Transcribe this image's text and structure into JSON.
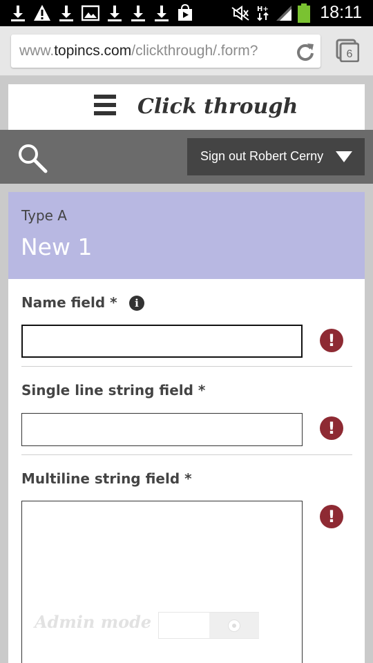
{
  "status_bar": {
    "time": "18:11",
    "icons": [
      "download-icon",
      "warning-icon",
      "download-icon",
      "image-icon",
      "download-icon",
      "download-icon",
      "download-icon",
      "play-store-icon",
      "mute-icon",
      "hplus-data-icon",
      "signal-icon",
      "battery-icon"
    ],
    "data_label": "H+"
  },
  "browser": {
    "url_prefix": "www.",
    "url_domain": "topincs.com",
    "url_path": "/clickthrough/.form?",
    "tab_count": "6"
  },
  "app": {
    "title": "Click through",
    "signout_label": "Sign out Robert Cerny"
  },
  "form": {
    "type_label": "Type A",
    "record_name": "New 1",
    "fields": [
      {
        "label": "Name field *",
        "value": ""
      },
      {
        "label": "Single line string field *",
        "value": ""
      },
      {
        "label": "Multiline string field *",
        "value": ""
      }
    ],
    "admin_mode_label": "Admin mode",
    "info_glyph": "i",
    "error_glyph": "!"
  },
  "colors": {
    "form_header": "#b8b8e2",
    "error": "#8e2a33",
    "toolbar": "#6b6b6b",
    "signout_bg": "#444444"
  }
}
